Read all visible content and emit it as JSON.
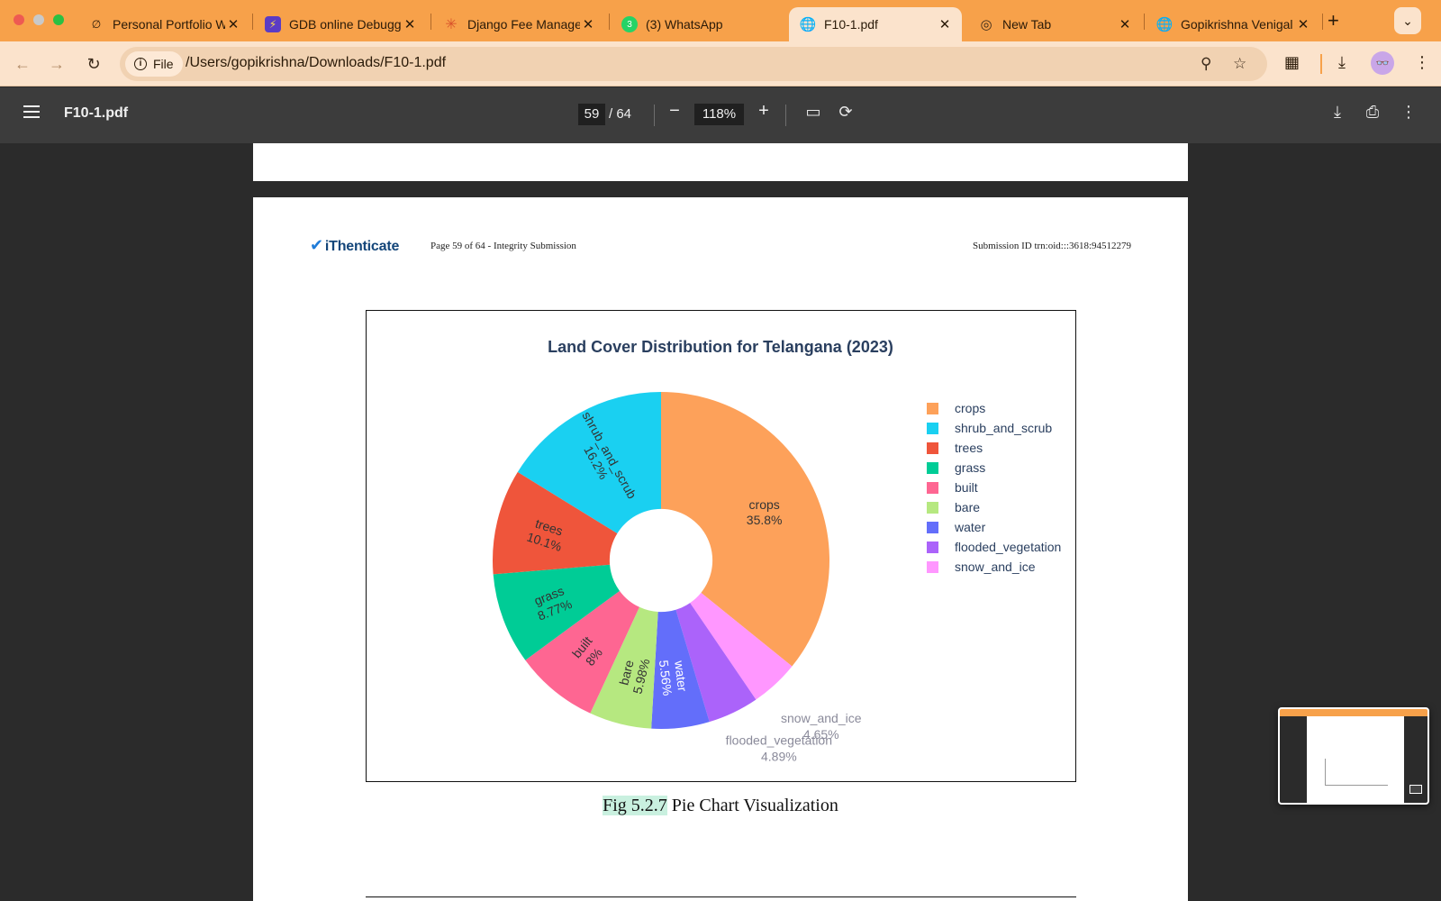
{
  "browser": {
    "tabs": [
      {
        "title": "Personal Portfolio W",
        "icon": "portfolio-icon",
        "active": false
      },
      {
        "title": "GDB online Debugger",
        "icon": "gdb-icon",
        "active": false
      },
      {
        "title": "Django Fee Managem",
        "icon": "spark-icon",
        "active": false
      },
      {
        "title": "(3) WhatsApp",
        "icon": "whatsapp-icon",
        "badge": "3",
        "active": false
      },
      {
        "title": "F10-1.pdf",
        "icon": "globe-icon",
        "active": true
      },
      {
        "title": "New Tab",
        "icon": "chrome-icon",
        "active": false
      },
      {
        "title": "Gopikrishna Venigal",
        "icon": "globe-icon",
        "active": false
      }
    ],
    "new_tab_glyph": "+",
    "address_chip": "File",
    "url": "/Users/gopikrishna/Downloads/F10-1.pdf",
    "accent_color": "#f7a14a"
  },
  "pdf_viewer": {
    "file_title": "F10-1.pdf",
    "current_page": "59",
    "page_total": "/ 64",
    "zoom": "118%"
  },
  "document": {
    "logo_text": "iThenticate",
    "page_info": "Page 59 of 64 - Integrity Submission",
    "submission_id": "Submission ID trn:oid:::3618:94512279",
    "figure_caption_label": "Fig 5.2.7",
    "figure_caption_text": " Pie Chart Visualization"
  },
  "chart_data": {
    "type": "pie",
    "hole": 0.3,
    "title": "Land Cover Distribution for Telangana (2023)",
    "labels": [
      "crops",
      "shrub_and_scrub",
      "trees",
      "grass",
      "built",
      "bare",
      "water",
      "flooded_vegetation",
      "snow_and_ice"
    ],
    "values": [
      35.8,
      16.2,
      10.1,
      8.77,
      8,
      5.98,
      5.56,
      4.89,
      4.65
    ],
    "value_labels": [
      "35.8%",
      "16.2%",
      "10.1%",
      "8.77%",
      "8%",
      "5.98%",
      "5.56%",
      "4.89%",
      "4.65%"
    ],
    "colors": [
      "#fda15a",
      "#1ad0f1",
      "#ef553b",
      "#00cc96",
      "#fe6692",
      "#b6e880",
      "#636efa",
      "#ab63fa",
      "#ff97ff"
    ],
    "slice_order_clockwise_from_top": [
      "crops",
      "snow_and_ice",
      "flooded_vegetation",
      "water",
      "bare",
      "built",
      "grass",
      "trees",
      "shrub_and_scrub"
    ],
    "legend_position": "right",
    "legend": [
      "crops",
      "shrub_and_scrub",
      "trees",
      "grass",
      "built",
      "bare",
      "water",
      "flooded_vegetation",
      "snow_and_ice"
    ]
  }
}
